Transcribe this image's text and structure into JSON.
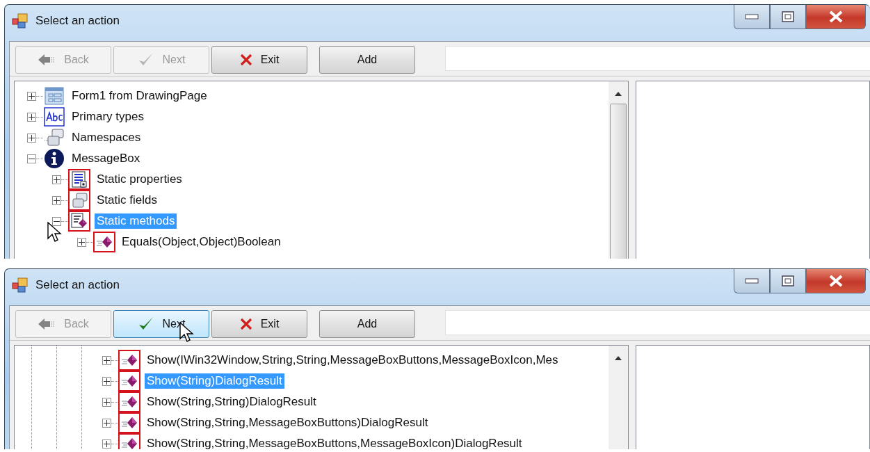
{
  "windows": [
    {
      "title": "Select an action",
      "buttons": [
        {
          "label": "Back",
          "kind": "back",
          "disabled": true,
          "hovered": false
        },
        {
          "label": "Next",
          "kind": "next",
          "disabled": true,
          "hovered": false
        },
        {
          "label": "Exit",
          "kind": "exit",
          "disabled": false,
          "hovered": false
        },
        {
          "label": "Add",
          "kind": "add",
          "disabled": false,
          "hovered": false
        }
      ],
      "tree": [
        {
          "label": "Form1 from DrawingPage",
          "kind": "form",
          "static": false,
          "expanded": false,
          "selected": false,
          "hovered": false
        },
        {
          "label": "Primary types",
          "kind": "abc",
          "static": false,
          "expanded": false,
          "selected": false,
          "hovered": false
        },
        {
          "label": "Namespaces",
          "kind": "namespace",
          "static": false,
          "expanded": false,
          "selected": false,
          "hovered": false
        },
        {
          "label": "MessageBox",
          "kind": "info",
          "static": false,
          "expanded": true,
          "selected": false,
          "hovered": false,
          "children": [
            {
              "label": "Static properties",
              "kind": "properties",
              "static": true,
              "expanded": false,
              "selected": false,
              "hovered": false
            },
            {
              "label": "Static fields",
              "kind": "fields",
              "static": true,
              "expanded": false,
              "selected": false,
              "hovered": false
            },
            {
              "label": "Static methods",
              "kind": "methods",
              "static": true,
              "expanded": true,
              "selected": true,
              "hovered": true,
              "children": [
                {
                  "label": "Equals(Object,Object)Boolean",
                  "kind": "method",
                  "static": true,
                  "expanded": false,
                  "selected": false,
                  "hovered": false
                }
              ]
            }
          ]
        }
      ]
    },
    {
      "title": "Select an action",
      "buttons": [
        {
          "label": "Back",
          "kind": "back",
          "disabled": true,
          "hovered": false
        },
        {
          "label": "Next",
          "kind": "next",
          "disabled": false,
          "hovered": true
        },
        {
          "label": "Exit",
          "kind": "exit",
          "disabled": false,
          "hovered": false
        },
        {
          "label": "Add",
          "kind": "add",
          "disabled": false,
          "hovered": false
        }
      ],
      "tree": [
        {
          "label": "Show(IWin32Window,String,String,MessageBoxButtons,MessageBoxIcon,Mes",
          "kind": "method",
          "static": true,
          "expanded": false,
          "selected": false,
          "hovered": false
        },
        {
          "label": "Show(String)DialogResult",
          "kind": "method",
          "static": true,
          "expanded": false,
          "selected": true,
          "hovered": false
        },
        {
          "label": "Show(String,String)DialogResult",
          "kind": "method",
          "static": true,
          "expanded": false,
          "selected": false,
          "hovered": false
        },
        {
          "label": "Show(String,String,MessageBoxButtons)DialogResult",
          "kind": "method",
          "static": true,
          "expanded": false,
          "selected": false,
          "hovered": false
        },
        {
          "label": "Show(String,String,MessageBoxButtons,MessageBoxIcon)DialogResult",
          "kind": "method",
          "static": true,
          "expanded": false,
          "selected": false,
          "hovered": false
        }
      ]
    }
  ]
}
